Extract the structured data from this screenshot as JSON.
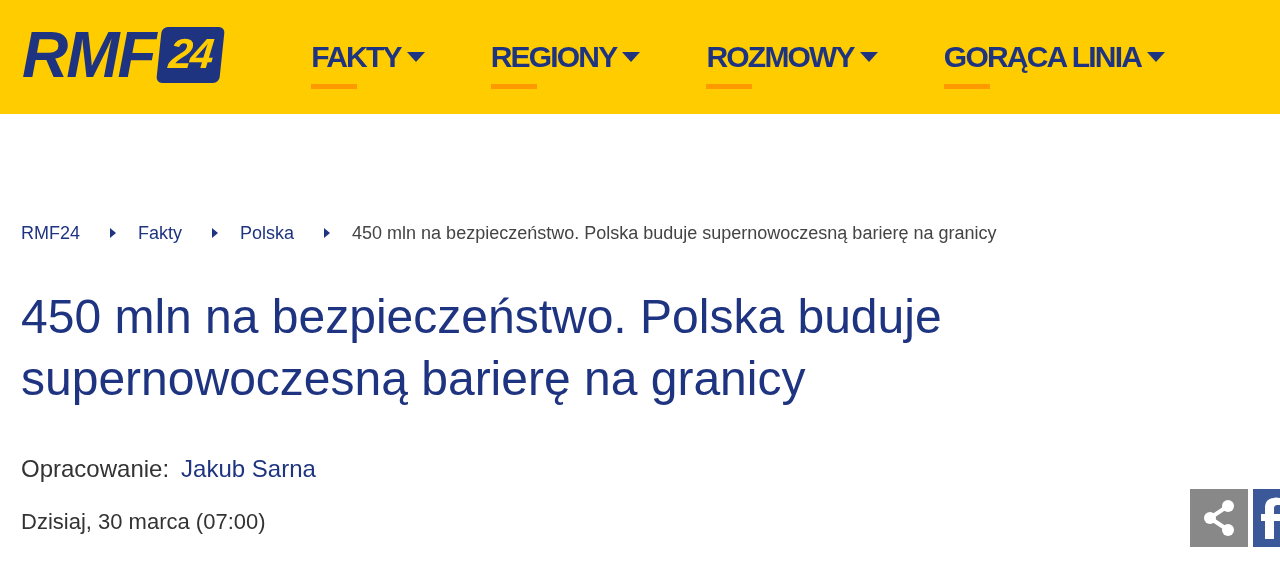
{
  "logo": {
    "text": "RMF",
    "badge": "24"
  },
  "nav": [
    {
      "label": "FAKTY"
    },
    {
      "label": "REGIONY"
    },
    {
      "label": "ROZMOWY"
    },
    {
      "label": "GORĄCA LINIA"
    }
  ],
  "breadcrumb": [
    {
      "label": "RMF24",
      "kind": "link"
    },
    {
      "label": "Fakty",
      "kind": "link"
    },
    {
      "label": "Polska",
      "kind": "link"
    },
    {
      "label": "450 mln na bezpieczeństwo. Polska buduje supernowoczesną barierę na granicy",
      "kind": "current"
    }
  ],
  "article": {
    "title": "450 mln na bezpieczeństwo. Polska buduje supernowoczesną barierę na granicy",
    "author_label": "Opracowanie:",
    "author": "Jakub Sarna",
    "date": "Dzisiaj, 30 marca (07:00)"
  }
}
